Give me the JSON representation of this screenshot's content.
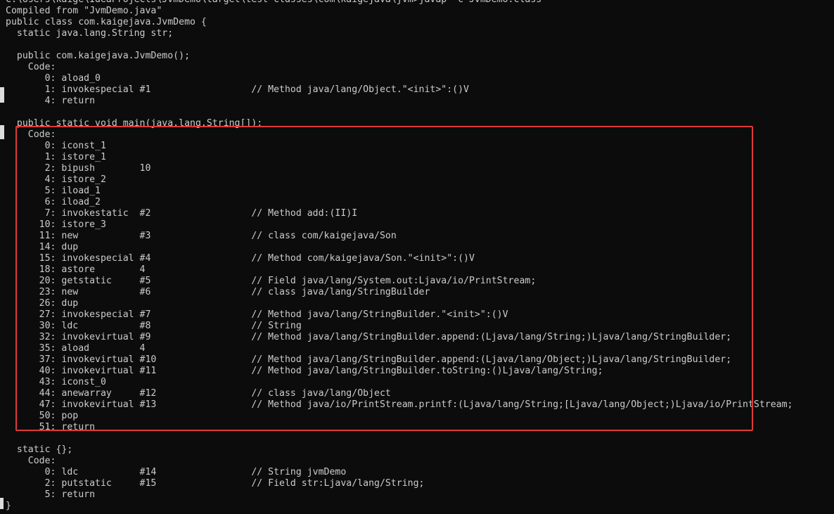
{
  "terminal": {
    "lines": [
      "C:\\Users\\kaige\\IdeaProjects\\JvmDemo\\target\\test-classes\\com\\kaigejava\\jvm>javap -c JvmDemo.class",
      "Compiled from \"JvmDemo.java\"",
      "public class com.kaigejava.JvmDemo {",
      "  static java.lang.String str;",
      "",
      "  public com.kaigejava.JvmDemo();",
      "    Code:",
      "       0: aload_0",
      "       1: invokespecial #1                  // Method java/lang/Object.\"<init>\":()V",
      "       4: return",
      "",
      "  public static void main(java.lang.String[]);",
      "    Code:",
      "       0: iconst_1",
      "       1: istore_1",
      "       2: bipush        10",
      "       4: istore_2",
      "       5: iload_1",
      "       6: iload_2",
      "       7: invokestatic  #2                  // Method add:(II)I",
      "      10: istore_3",
      "      11: new           #3                  // class com/kaigejava/Son",
      "      14: dup",
      "      15: invokespecial #4                  // Method com/kaigejava/Son.\"<init>\":()V",
      "      18: astore        4",
      "      20: getstatic     #5                  // Field java/lang/System.out:Ljava/io/PrintStream;",
      "      23: new           #6                  // class java/lang/StringBuilder",
      "      26: dup",
      "      27: invokespecial #7                  // Method java/lang/StringBuilder.\"<init>\":()V",
      "      30: ldc           #8                  // String",
      "      32: invokevirtual #9                  // Method java/lang/StringBuilder.append:(Ljava/lang/String;)Ljava/lang/StringBuilder;",
      "      35: aload         4",
      "      37: invokevirtual #10                 // Method java/lang/StringBuilder.append:(Ljava/lang/Object;)Ljava/lang/StringBuilder;",
      "      40: invokevirtual #11                 // Method java/lang/StringBuilder.toString:()Ljava/lang/String;",
      "      43: iconst_0",
      "      44: anewarray     #12                 // class java/lang/Object",
      "      47: invokevirtual #13                 // Method java/io/PrintStream.printf:(Ljava/lang/String;[Ljava/lang/Object;)Ljava/io/PrintStream;",
      "      50: pop",
      "      51: return",
      "",
      "  static {};",
      "    Code:",
      "       0: ldc           #14                 // String jvmDemo",
      "       2: putstatic     #15                 // Field str:Ljava/lang/String;",
      "       5: return",
      "}"
    ]
  },
  "colors": {
    "background": "#0c0c0c",
    "text": "#cccccc",
    "highlight_border": "#e03a3a"
  }
}
